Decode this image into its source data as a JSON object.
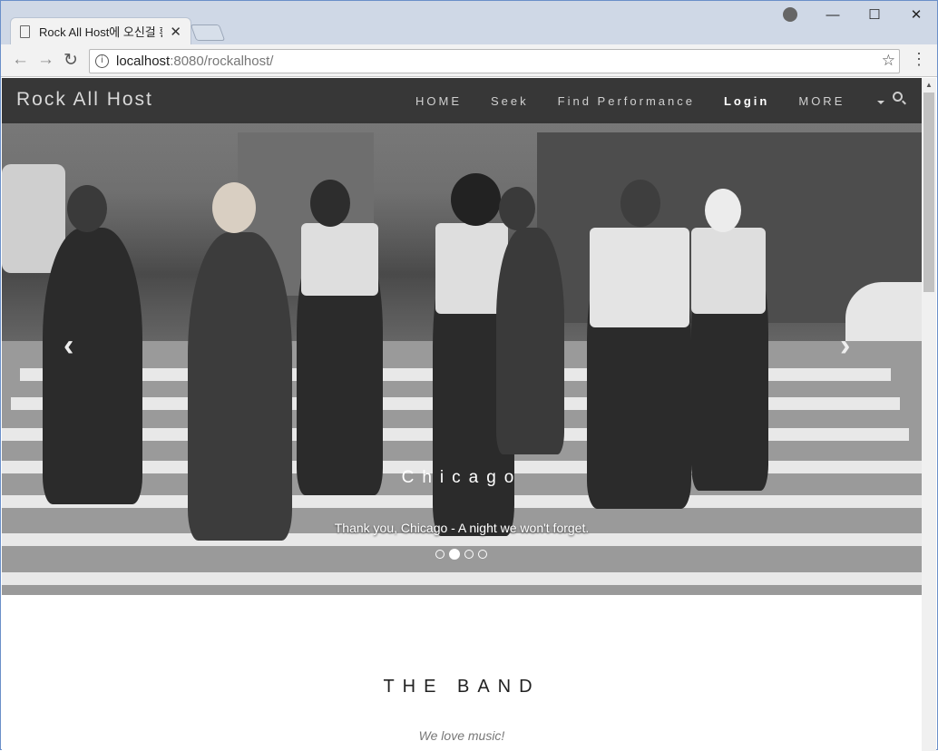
{
  "browser": {
    "tab_title": "Rock All Host에 오신걸 환영합니다",
    "tab_close": "✕",
    "back": "←",
    "forward": "→",
    "reload": "↻",
    "url_host": "localhost",
    "url_rest": ":8080/rockalhost/",
    "window_controls": {
      "minimize": "—",
      "maximize": "☐",
      "close": "✕"
    },
    "star": "☆",
    "menu": "⋮"
  },
  "site": {
    "brand": "Rock All Host",
    "nav": {
      "home": "HOME",
      "seek": "Seek",
      "find": "Find Performance",
      "login": "Login",
      "more": "MORE"
    },
    "carousel": {
      "title": "Chicago",
      "caption": "Thank you, Chicago - A night we won't forget.",
      "prev": "‹",
      "next": "›",
      "slide_count": 4,
      "active_slide": 2
    },
    "band": {
      "title": "THE BAND",
      "subtitle": "We love music!"
    }
  }
}
